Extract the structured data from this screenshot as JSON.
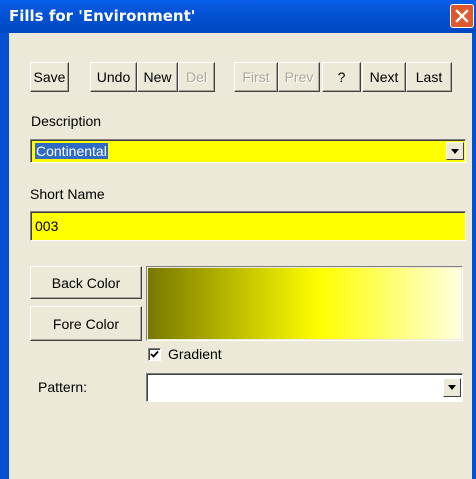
{
  "window": {
    "title": "Fills for 'Environment'"
  },
  "toolbar": {
    "save": "Save",
    "undo": "Undo",
    "new": "New",
    "del": "Del",
    "first": "First",
    "prev": "Prev",
    "help": "?",
    "next": "Next",
    "last": "Last"
  },
  "description": {
    "label": "Description",
    "value": "Continental"
  },
  "short_name": {
    "label": "Short Name",
    "value": "003"
  },
  "colors": {
    "back_button": "Back Color",
    "fore_button": "Fore Color",
    "fore_color": "#787800",
    "back_color": "#ffffe0",
    "field_highlight": "#ffff00"
  },
  "gradient": {
    "label": "Gradient",
    "checked": true
  },
  "pattern": {
    "label": "Pattern:",
    "value": ""
  }
}
